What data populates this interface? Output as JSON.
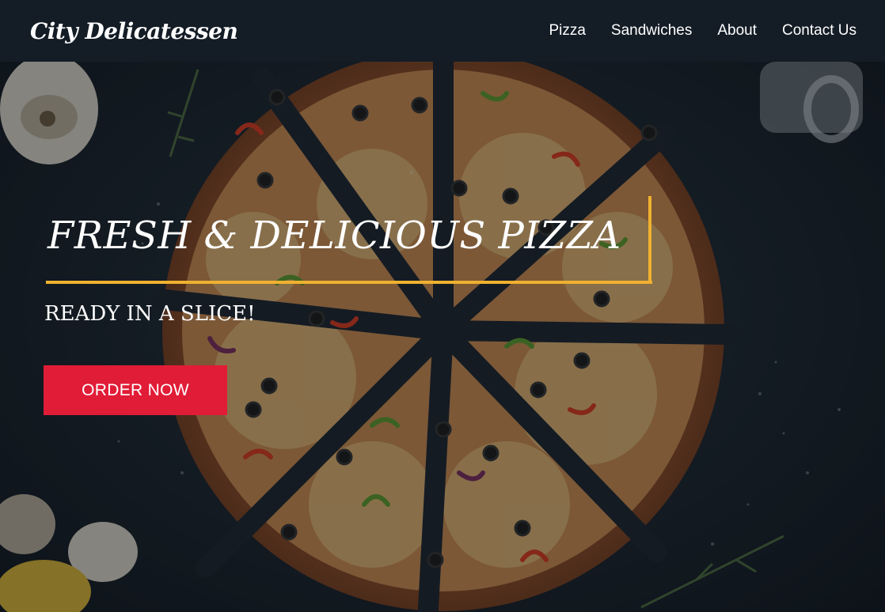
{
  "header": {
    "brand": "City Delicatessen",
    "nav": [
      {
        "label": "Pizza"
      },
      {
        "label": "Sandwiches"
      },
      {
        "label": "About"
      },
      {
        "label": "Contact Us"
      }
    ]
  },
  "hero": {
    "headline": "FRESH & DELICIOUS PIZZA",
    "subheading": "READY IN A SLICE!",
    "cta_label": "ORDER NOW",
    "image_icon": "pizza-photo"
  },
  "colors": {
    "navbar_bg": "#141d26",
    "accent_gold": "#efb12f",
    "cta_red": "#e11c37",
    "text": "#ffffff"
  }
}
